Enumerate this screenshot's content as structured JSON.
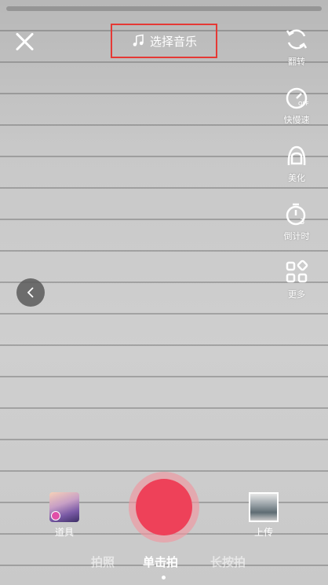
{
  "top": {
    "music_label": "选择音乐"
  },
  "tools": [
    {
      "label": "翻转",
      "icon": "flip-camera-icon"
    },
    {
      "label": "快慢速",
      "icon": "speed-icon"
    },
    {
      "label": "美化",
      "icon": "beauty-icon"
    },
    {
      "label": "倒计时",
      "icon": "timer-icon"
    },
    {
      "label": "更多",
      "icon": "more-grid-icon"
    }
  ],
  "bottom": {
    "props_label": "道具",
    "upload_label": "上传",
    "modes": [
      "拍照",
      "单击拍",
      "长按拍"
    ],
    "active_mode": "单击拍"
  },
  "colors": {
    "shutter": "#ee4159",
    "highlight_border": "#e53935"
  }
}
